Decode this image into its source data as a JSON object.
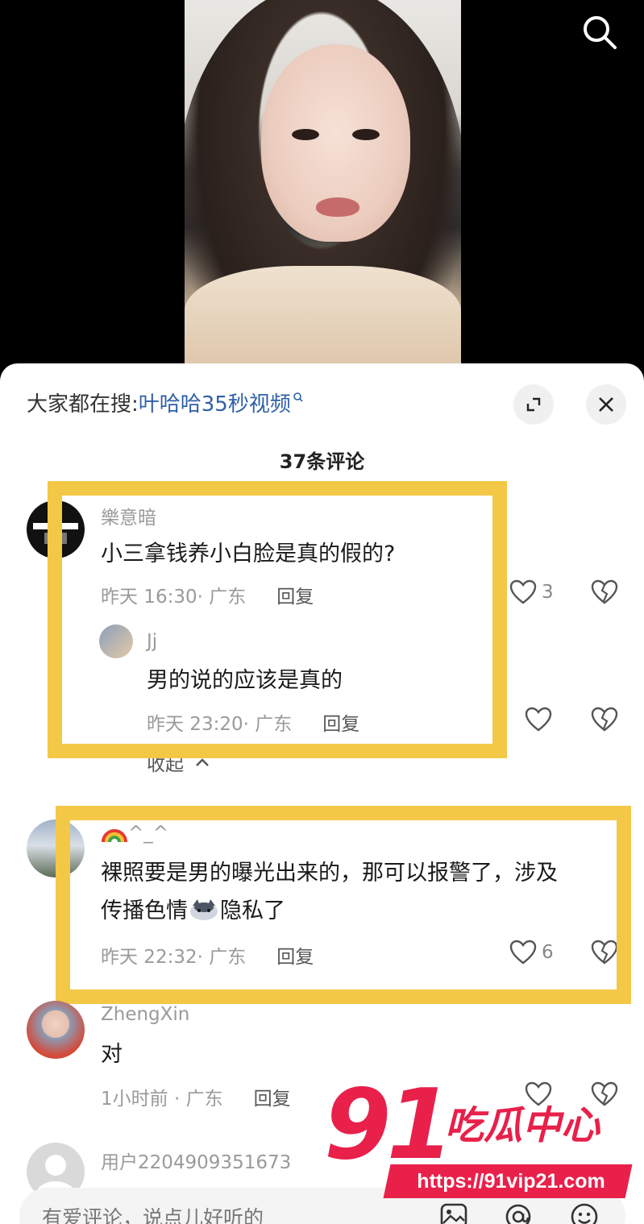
{
  "hot_search": {
    "label": "大家都在搜:",
    "keyword": "叶哈哈35秒视频"
  },
  "comment_count": "37条评论",
  "comments": [
    {
      "user": "樂意暗",
      "text": "小三拿钱养小白脸是真的假的?",
      "time": "昨天 16:30· 广东",
      "reply_label": "回复",
      "likes": "3",
      "replies": [
        {
          "user": "Jj",
          "text": "男的说的应该是真的",
          "time": "昨天 23:20· 广东",
          "reply_label": "回复",
          "likes": ""
        }
      ]
    },
    {
      "user": "^_^",
      "text_line1": "裸照要是男的曝光出来的，那可以报警了，涉及",
      "text_line2a": "传播色情",
      "text_line2b": "隐私了",
      "time": "昨天 22:32· 广东",
      "reply_label": "回复",
      "likes": "6"
    },
    {
      "user": "ZhengXin",
      "text": "对",
      "time": "1小时前 · 广东",
      "reply_label": "回复",
      "likes": ""
    },
    {
      "user": "用户2204909351673"
    }
  ],
  "collapse_label": "收起",
  "input_placeholder": "有爱评论，说点儿好听的",
  "watermark": {
    "number": "91",
    "brand": "吃瓜中心",
    "url": "https://91vip21.com"
  },
  "colors": {
    "highlight": "#f3c846",
    "keyword": "#2f5fa8",
    "watermark_red": "#e8204a"
  }
}
